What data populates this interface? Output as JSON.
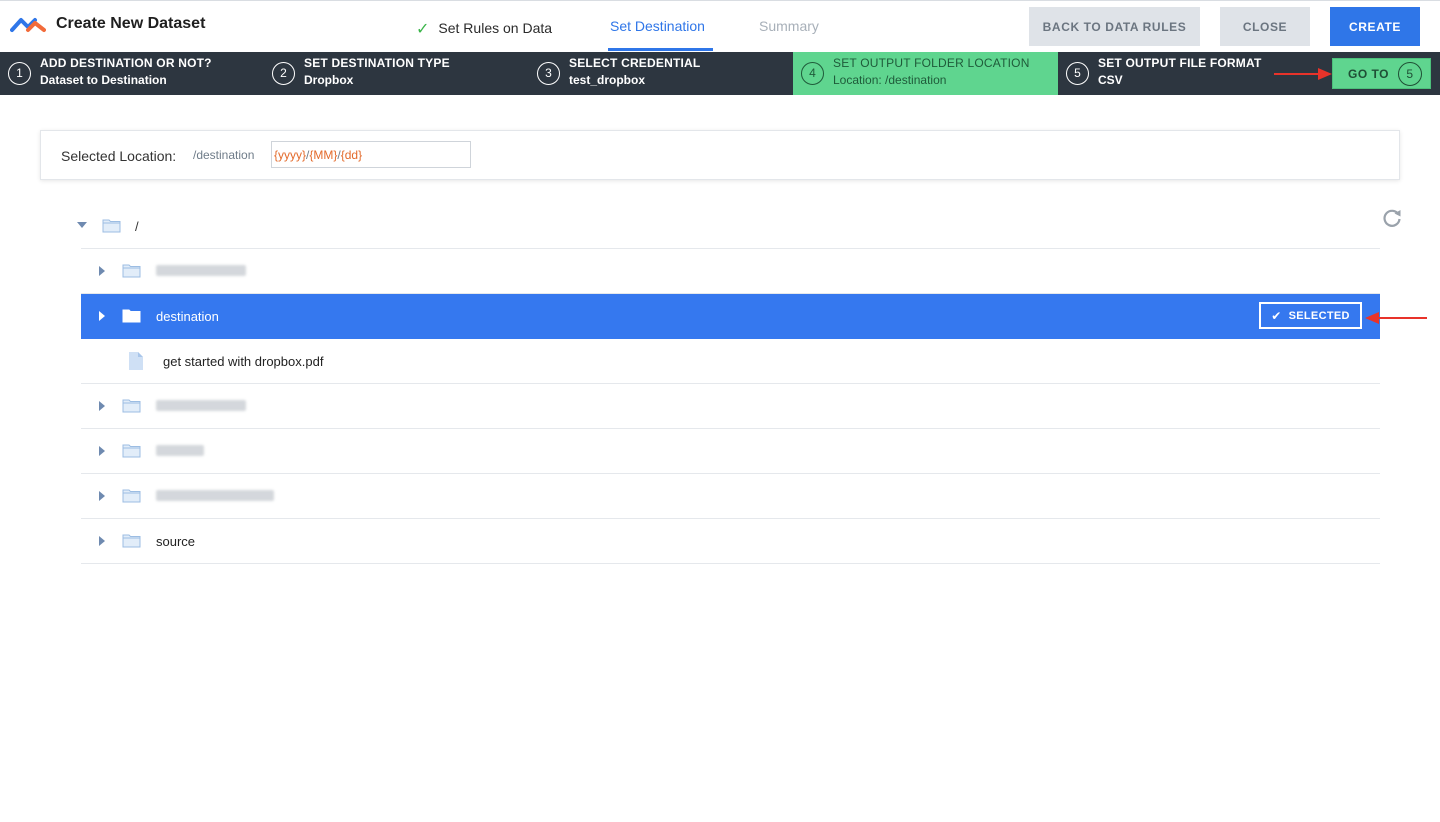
{
  "header": {
    "title": "Create New Dataset",
    "tabs": [
      {
        "label": "Set Rules on Data",
        "state": "done"
      },
      {
        "label": "Set Destination",
        "state": "active"
      },
      {
        "label": "Summary",
        "state": "pending"
      }
    ],
    "buttons": {
      "back": "BACK TO DATA RULES",
      "close": "CLOSE",
      "create": "CREATE"
    },
    "accent_color": "#2f76e8"
  },
  "steps": [
    {
      "num": "1",
      "title": "ADD DESTINATION OR NOT?",
      "value": "Dataset to Destination"
    },
    {
      "num": "2",
      "title": "SET DESTINATION TYPE",
      "value": "Dropbox"
    },
    {
      "num": "3",
      "title": "SELECT CREDENTIAL",
      "value": "test_dropbox"
    },
    {
      "num": "4",
      "title": "SET OUTPUT FOLDER LOCATION",
      "value": "Location: /destination",
      "active": true
    },
    {
      "num": "5",
      "title": "SET OUTPUT FILE FORMAT",
      "value": "CSV"
    }
  ],
  "goto": {
    "label": "GO TO",
    "num": "5"
  },
  "location": {
    "label": "Selected Location:",
    "path": "/destination",
    "pattern_parts": [
      "{yyyy}",
      "/",
      "{MM}",
      "/",
      "{dd}"
    ]
  },
  "tree": {
    "root": "/",
    "rows": [
      {
        "type": "folder",
        "name": "",
        "blurred": true
      },
      {
        "type": "folder",
        "name": "destination",
        "selected": true,
        "badge": "SELECTED"
      },
      {
        "type": "file",
        "name": "get started with dropbox.pdf"
      },
      {
        "type": "folder",
        "name": "",
        "blurred": true
      },
      {
        "type": "folder",
        "name": "",
        "blurred": true
      },
      {
        "type": "folder",
        "name": "",
        "blurred": true
      },
      {
        "type": "folder",
        "name": "source"
      }
    ]
  },
  "icons": {
    "done": "check-icon",
    "refresh": "refresh-icon",
    "folder": "folder-icon",
    "file": "file-icon"
  },
  "colors": {
    "steps_bg": "#2d3640",
    "active_step": "#5fd58f",
    "selected_row": "#3578ef",
    "pattern_token": "#e36a2b",
    "annotation_arrow": "#e8332a"
  }
}
